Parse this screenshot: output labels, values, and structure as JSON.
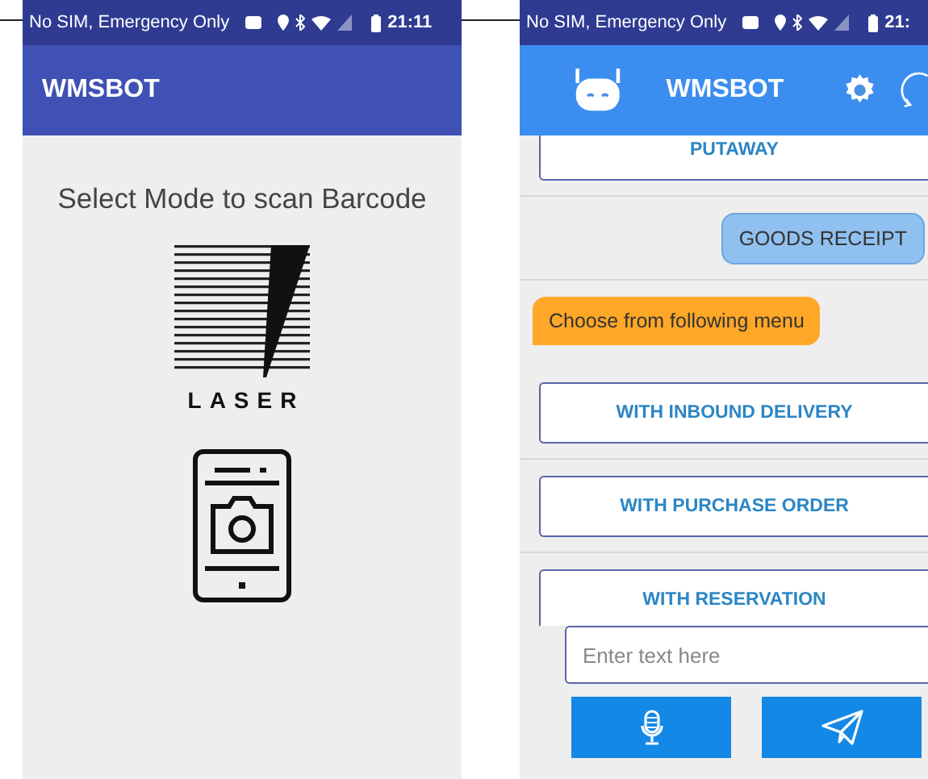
{
  "left_screen": {
    "status_bar": {
      "carrier": "No SIM, Emergency Only",
      "time": "21:11"
    },
    "app_bar": {
      "title": "WMSBOT"
    },
    "prompt": "Select Mode to scan Barcode",
    "modes": [
      {
        "kind": "laser",
        "label": "LASER"
      },
      {
        "kind": "camera"
      }
    ]
  },
  "right_screen": {
    "status_bar": {
      "carrier": "No SIM, Emergency Only",
      "time": "21:"
    },
    "app_bar": {
      "title": "WMSBOT"
    },
    "messages": [
      {
        "kind": "option",
        "text": "PUTAWAY"
      },
      {
        "kind": "user",
        "text": "GOODS RECEIPT"
      },
      {
        "kind": "bot",
        "text": "Choose from following menu"
      },
      {
        "kind": "option",
        "text": "WITH INBOUND DELIVERY"
      },
      {
        "kind": "option",
        "text": "WITH PURCHASE ORDER"
      },
      {
        "kind": "option",
        "text": "WITH RESERVATION"
      }
    ],
    "input": {
      "placeholder": "Enter text here"
    }
  }
}
